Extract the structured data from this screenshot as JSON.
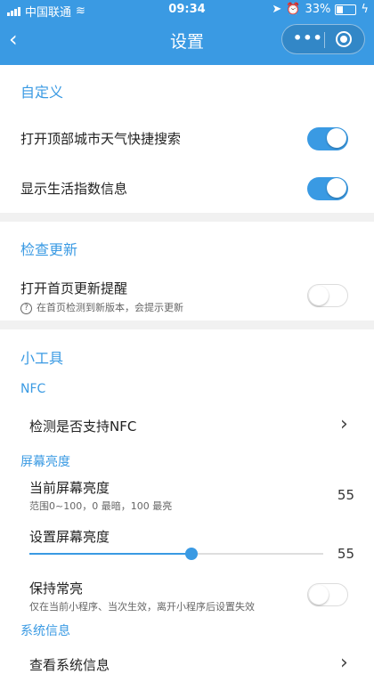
{
  "status_bar": {
    "carrier": "中国联通",
    "time": "09:34",
    "battery": "33%"
  },
  "nav": {
    "title": "设置",
    "back_icon": "chevron-left-icon",
    "more_icon": "more-dots-icon",
    "close_icon": "record-circle-icon"
  },
  "custom": {
    "title": "自定义",
    "items": [
      {
        "label": "打开顶部城市天气快捷搜索",
        "enabled": true
      },
      {
        "label": "显示生活指数信息",
        "enabled": true
      }
    ]
  },
  "update": {
    "title": "检查更新",
    "item": {
      "label": "打开首页更新提醒",
      "hint": "在首页检测到新版本，会提示更新",
      "enabled": false
    }
  },
  "tools": {
    "title": "小工具",
    "nfc": {
      "title": "NFC",
      "item_label": "检测是否支持NFC"
    },
    "brightness": {
      "title": "屏幕亮度",
      "current_label": "当前屏幕亮度",
      "current_hint": "范围0~100，0 最暗，100 最亮",
      "current_value": "55",
      "set_label": "设置屏幕亮度",
      "slider_value": "55",
      "slider_fraction": 0.55,
      "keep_on_label": "保持常亮",
      "keep_on_hint": "仅在当前小程序、当次生效，离开小程序后设置失效",
      "keep_on_enabled": false
    },
    "system": {
      "title": "系统信息",
      "item_label": "查看系统信息"
    }
  },
  "colors": {
    "accent": "#3a9ae3",
    "divider": "#f1f1f1"
  }
}
